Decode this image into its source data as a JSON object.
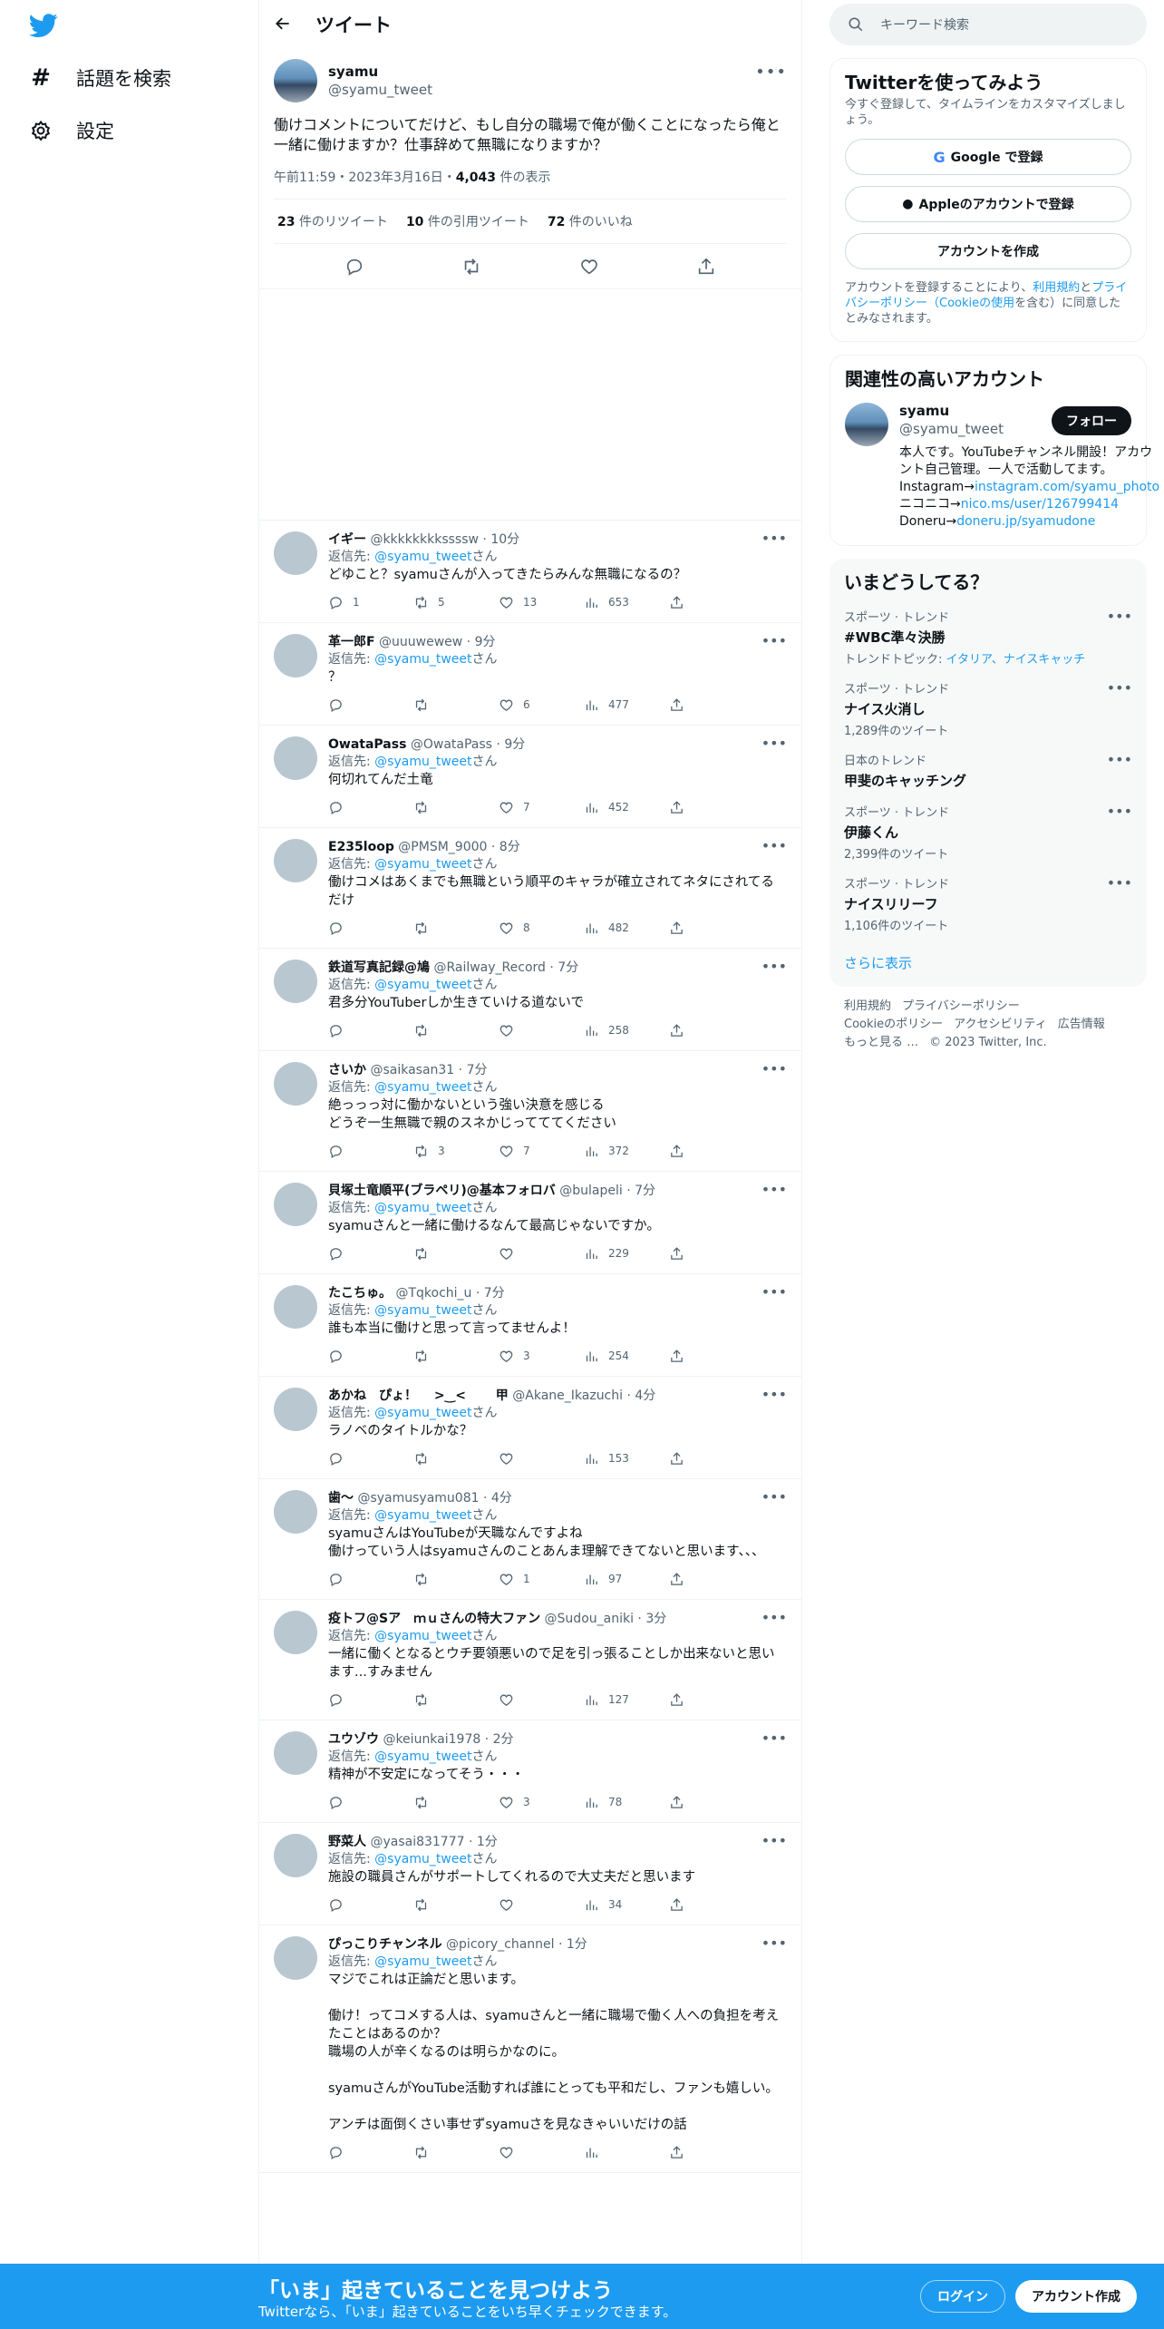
{
  "nav": {
    "items": [
      {
        "label": "話題を検索",
        "icon": "hashtag-icon"
      },
      {
        "label": "設定",
        "icon": "gear-icon"
      }
    ]
  },
  "header": {
    "title": "ツイート"
  },
  "tweet": {
    "name": "syamu",
    "handle": "@syamu_tweet",
    "text": "働けコメントについてだけど、もし自分の職場で俺が働くことになったら俺と一緒に働けますか？仕事辞めて無職になりますか？",
    "time": "午前11:59・2023年3月16日・",
    "views": "4,043",
    "views_label": " 件の表示",
    "retweets": "23",
    "retweets_label": " 件のリツイート",
    "quotes": "10",
    "quotes_label": " 件の引用ツイート",
    "likes": "72",
    "likes_label": " 件のいいね"
  },
  "replies": [
    {
      "name": "イギー",
      "handle": "@kkkkkkkkssssw",
      "time": "10分",
      "to": "@syamu_tweet",
      "text": "どゆこと？syamuさんが入ってきたらみんな無職になるの？",
      "reply_count": "1",
      "retweet_count": "5",
      "like_count": "13",
      "view_count": "653"
    },
    {
      "name": "革一郎F",
      "handle": "@uuuwewew",
      "time": "9分",
      "to": "@syamu_tweet",
      "text": "？",
      "reply_count": "",
      "retweet_count": "",
      "like_count": "6",
      "view_count": "477"
    },
    {
      "name": "OwataPass",
      "handle": "@OwataPass",
      "time": "9分",
      "to": "@syamu_tweet",
      "text": "何切れてんだ土竜",
      "reply_count": "",
      "retweet_count": "",
      "like_count": "7",
      "view_count": "452"
    },
    {
      "name": "E235loop",
      "handle": "@PMSM_9000",
      "time": "8分",
      "to": "@syamu_tweet",
      "text": "働けコメはあくまでも無職という順平のキャラが確立されてネタにされてるだけ",
      "reply_count": "",
      "retweet_count": "",
      "like_count": "8",
      "view_count": "482"
    },
    {
      "name": "鉄道写真記録@鳩",
      "handle": "@Railway_Record",
      "time": "7分",
      "to": "@syamu_tweet",
      "text": "君多分YouTuberしか生きていける道ないで",
      "reply_count": "",
      "retweet_count": "",
      "like_count": "",
      "view_count": "258"
    },
    {
      "name": "さいか",
      "handle": "@saikasan31",
      "time": "7分",
      "to": "@syamu_tweet",
      "text": "絶っっっ対に働かないという強い決意を感じる\nどうぞ一生無職で親のスネかじってててください",
      "reply_count": "",
      "retweet_count": "3",
      "like_count": "7",
      "view_count": "372"
    },
    {
      "name": "貝塚土竜順平(ブラペリ)@基本フォロバ",
      "handle": "@bulapeli",
      "time": "7分",
      "to": "@syamu_tweet",
      "text": "syamuさんと一緒に働けるなんて最高じゃないですか。",
      "reply_count": "",
      "retweet_count": "",
      "like_count": "",
      "view_count": "229"
    },
    {
      "name": "たこちゅ。",
      "handle": "@Tqkochi_u",
      "time": "7分",
      "to": "@syamu_tweet",
      "text": "誰も本当に働けと思って言ってませんよ！",
      "reply_count": "",
      "retweet_count": "",
      "like_count": "3",
      "view_count": "254"
    },
    {
      "name": "あかね　ぴょ！　 >‿<　　 甲",
      "handle": "@Akane_Ikazuchi",
      "time": "4分",
      "to": "@syamu_tweet",
      "text": "ラノベのタイトルかな？",
      "reply_count": "",
      "retweet_count": "",
      "like_count": "",
      "view_count": "153"
    },
    {
      "name": "歯〜",
      "handle": "@syamusyamu081",
      "time": "4分",
      "to": "@syamu_tweet",
      "text": "syamuさんはYouTubeが天職なんですよね\n働けっていう人はsyamuさんのことあんま理解できてないと思います、、、",
      "reply_count": "",
      "retweet_count": "",
      "like_count": "1",
      "view_count": "97"
    },
    {
      "name": "疫トフ@Sア　ｍｕさんの特大ファン",
      "handle": "@Sudou_aniki",
      "time": "3分",
      "to": "@syamu_tweet",
      "text": "一緒に働くとなるとウチ要領悪いので足を引っ張ることしか出来ないと思います...すみません",
      "reply_count": "",
      "retweet_count": "",
      "like_count": "",
      "view_count": "127"
    },
    {
      "name": "ユウゾウ",
      "handle": "@keiunkai1978",
      "time": "2分",
      "to": "@syamu_tweet",
      "text": "精神が不安定になってそう・・・",
      "reply_count": "",
      "retweet_count": "",
      "like_count": "3",
      "view_count": "78"
    },
    {
      "name": "野菜人",
      "handle": "@yasai831777",
      "time": "1分",
      "to": "@syamu_tweet",
      "text": "施設の職員さんがサポートしてくれるので大丈夫だと思います",
      "reply_count": "",
      "retweet_count": "",
      "like_count": "",
      "view_count": "34"
    },
    {
      "name": "ぴっこりチャンネル",
      "handle": "@picory_channel",
      "time": "1分",
      "to": "@syamu_tweet",
      "text": "マジでこれは正論だと思います。\n\n働け！ってコメする人は、syamuさんと一緒に職場で働く人への負担を考えたことはあるのか？\n職場の人が辛くなるのは明らかなのに。\n\nsyamuさんがYouTube活動すれば誰にとっても平和だし、ファンも嬉しい。\n\nアンチは面倒くさい事せずsyamuさを見なきゃいいだけの話",
      "reply_count": "",
      "retweet_count": "",
      "like_count": "",
      "view_count": ""
    }
  ],
  "reply_prefix": "返信先: ",
  "reply_suffix": "さん",
  "search": {
    "placeholder": "キーワード検索"
  },
  "signup_card": {
    "title": "Twitterを使ってみよう",
    "sub": "今すぐ登録して、タイムラインをカスタマイズしましょう。",
    "google": "Google で登録",
    "apple": "Appleのアカウントで登録",
    "create": "アカウントを作成",
    "legal_1": "アカウントを登録することにより、",
    "legal_terms": "利用規約",
    "legal_2": "と",
    "legal_privacy": "プライバシーポリシー（Cookieの使用",
    "legal_3": "を含む）に同意したとみなされます。"
  },
  "related": {
    "title": "関連性の高いアカウント",
    "name": "syamu",
    "handle": "@syamu_tweet",
    "follow": "フォロー",
    "bio_1": "本人です。YouTubeチャンネル開設！アカウント自己管理。一人で活動してます。 Instagram→",
    "bio_link1": "instagram.com/syamu_photo",
    "bio_2": " ニコニコ→",
    "bio_link2": "nico.ms/user/126799414",
    "bio_3": " Doneru→",
    "bio_link3": "doneru.jp/syamudone"
  },
  "trends": {
    "title": "いまどうしてる？",
    "items": [
      {
        "cat": "スポーツ · トレンド",
        "name": "#WBC準々決勝",
        "sub_prefix": "トレンドトピック: ",
        "sub_links": "イタリア、ナイスキャッチ",
        "sub": ""
      },
      {
        "cat": "スポーツ · トレンド",
        "name": "ナイス火消し",
        "sub_prefix": "",
        "sub_links": "",
        "sub": "1,289件のツイート"
      },
      {
        "cat": "日本のトレンド",
        "name": "甲斐のキャッチング",
        "sub_prefix": "",
        "sub_links": "",
        "sub": ""
      },
      {
        "cat": "スポーツ · トレンド",
        "name": "伊藤くん",
        "sub_prefix": "",
        "sub_links": "",
        "sub": "2,399件のツイート"
      },
      {
        "cat": "スポーツ · トレンド",
        "name": "ナイスリリーフ",
        "sub_prefix": "",
        "sub_links": "",
        "sub": "1,106件のツイート"
      }
    ],
    "show_more": "さらに表示"
  },
  "footer": {
    "links": [
      "利用規約",
      "プライバシーポリシー",
      "Cookieのポリシー",
      "アクセシビリティ",
      "広告情報",
      "もっと見る …"
    ],
    "copyright": "© 2023 Twitter, Inc."
  },
  "bottom_bar": {
    "title": "「いま」起きていることを見つけよう",
    "sub": "Twitterなら、「いま」起きていることをいち早くチェックできます。",
    "login": "ログイン",
    "signup": "アカウント作成"
  },
  "colors": {
    "accent": "#1d9bf0",
    "text": "#0f1419",
    "muted": "#536471",
    "border": "#eff3f4"
  }
}
